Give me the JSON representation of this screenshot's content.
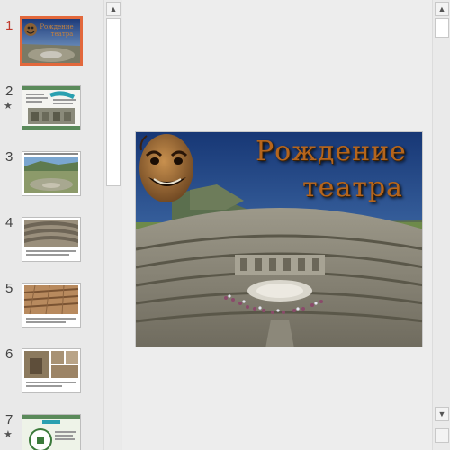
{
  "thumbnails": [
    {
      "number": "1",
      "starred": false
    },
    {
      "number": "2",
      "starred": true,
      "star": "★"
    },
    {
      "number": "3",
      "starred": false
    },
    {
      "number": "4",
      "starred": false
    },
    {
      "number": "5",
      "starred": false
    },
    {
      "number": "6",
      "starred": false
    },
    {
      "number": "7",
      "starred": true,
      "star": "★"
    }
  ],
  "slide": {
    "title_line1": "Рождение",
    "title_line2": "театра"
  },
  "thumb1": {
    "title": "Рождение театра"
  },
  "scroll": {
    "up": "▲",
    "down": "▼"
  },
  "colors": {
    "selection_border": "#e2683c",
    "active_number": "#c0392b",
    "title_text": "#b5651d"
  }
}
